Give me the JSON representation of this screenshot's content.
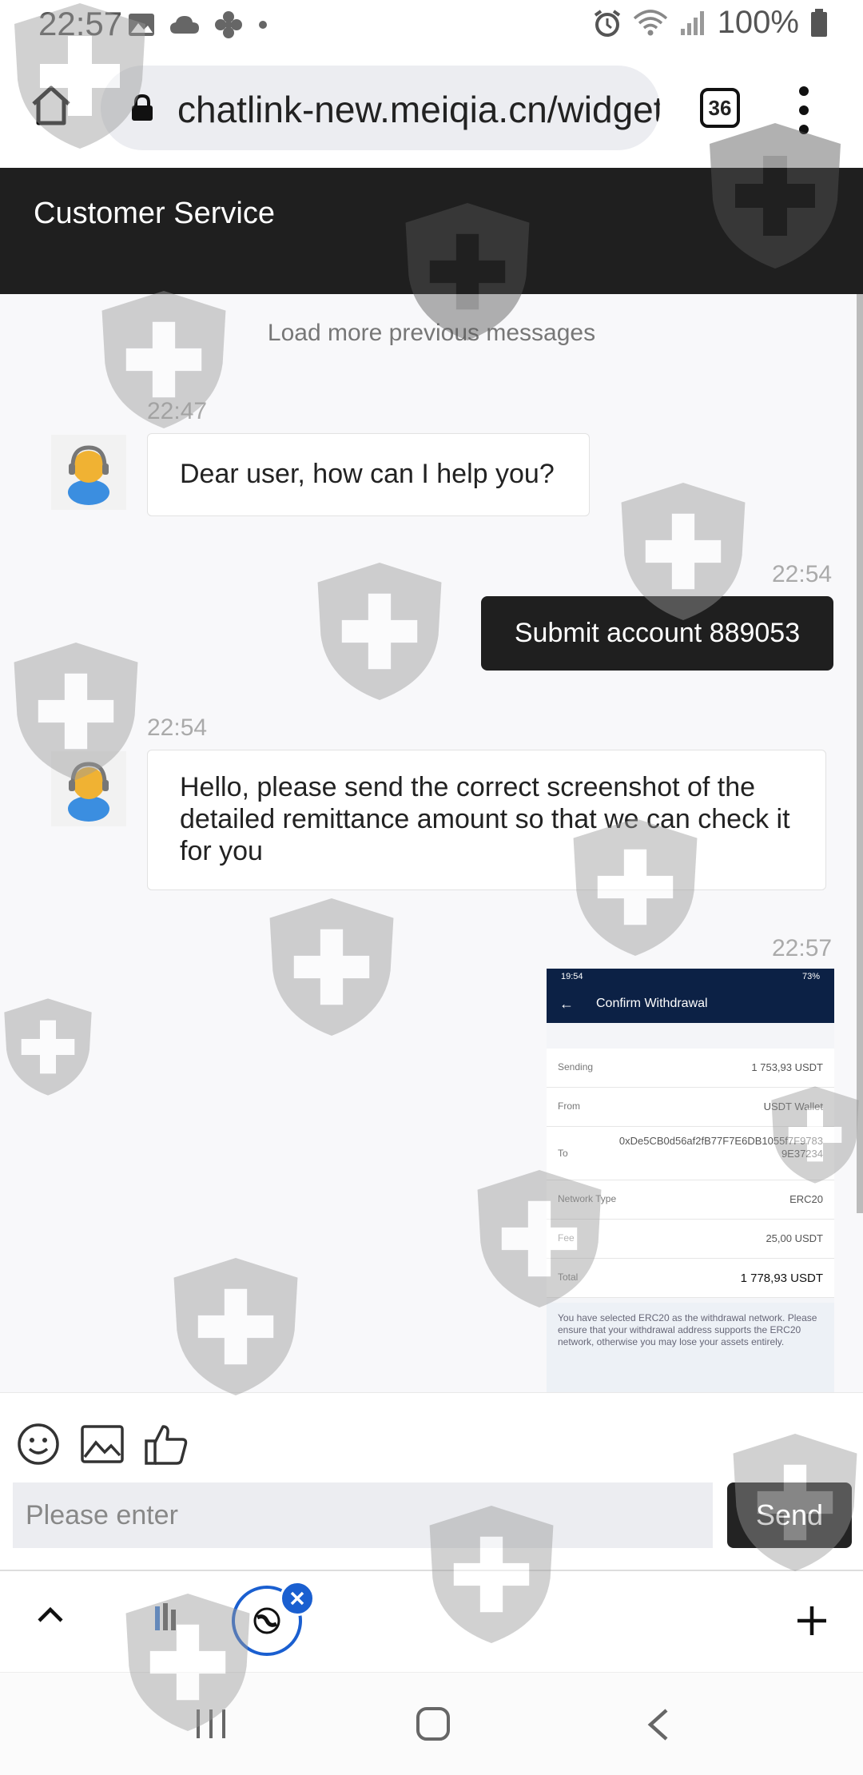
{
  "status_bar": {
    "time": "22:57",
    "battery": "100%",
    "icons_left": [
      "image-icon",
      "cloud-icon",
      "flower-icon",
      "dot-icon"
    ],
    "icons_right": [
      "alarm-icon",
      "wifi-icon",
      "signal-icon",
      "battery-icon"
    ]
  },
  "browser": {
    "url": "chatlink-new.meiqia.cn/widget",
    "tab_count": "36"
  },
  "chat": {
    "title": "Customer Service",
    "load_more": "Load more previous messages",
    "messages": [
      {
        "from": "agent",
        "time": "22:47",
        "text": "Dear user, how can I help you?"
      },
      {
        "from": "me",
        "time": "22:54",
        "text": "Submit account 889053"
      },
      {
        "from": "agent",
        "time": "22:54",
        "text": "Hello, please send the correct screenshot of the detailed remittance amount so that we can check it for you"
      },
      {
        "from": "me",
        "time": "22:57",
        "type": "image"
      }
    ],
    "image_message": {
      "status_time": "19:54",
      "status_battery": "73%",
      "title": "Confirm Withdrawal",
      "rows": [
        {
          "label": "Sending",
          "value": "1 753,93 USDT"
        },
        {
          "label": "From",
          "value": "USDT Wallet"
        },
        {
          "label": "To",
          "value": "0xDe5CB0d56af2fB77F7E6DB1055f7F9783 9E37234"
        },
        {
          "label": "Network Type",
          "value": "ERC20"
        },
        {
          "label": "Fee",
          "value": "25,00 USDT"
        },
        {
          "label": "Total",
          "value": "1 778,93 USDT"
        }
      ],
      "note": "You have selected ERC20 as the withdrawal network. Please ensure that your withdrawal address supports the ERC20 network, otherwise you may lose your assets entirely."
    }
  },
  "composer": {
    "placeholder": "Please enter",
    "send_label": "Send",
    "tools": [
      "emoji-icon",
      "image-icon",
      "thumbs-up-icon"
    ]
  },
  "colors": {
    "header_bg": "#1f1f1f",
    "thumb_header": "#0c2145",
    "close_badge": "#1a5fd0"
  }
}
